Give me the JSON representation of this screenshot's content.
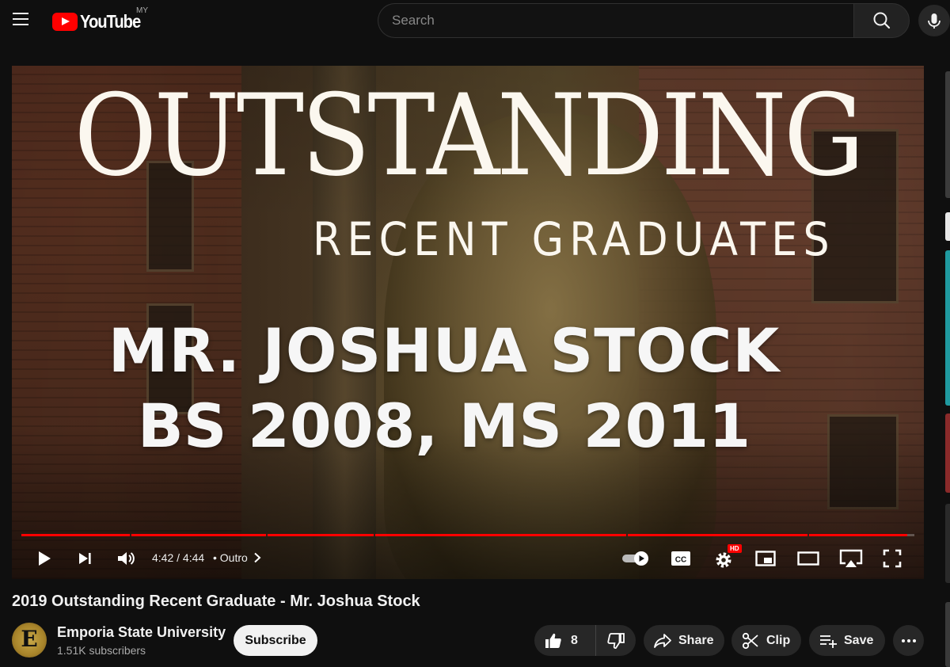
{
  "header": {
    "logo_text": "YouTube",
    "country_code": "MY",
    "search_placeholder": "Search"
  },
  "player": {
    "overlay": {
      "title_big": "OUTSTANDING",
      "title_sub": "RECENT GRADUATES",
      "name_line_1": "MR. JOSHUA STOCK",
      "name_line_2": "BS 2008, MS 2011"
    },
    "progress_fraction": 0.992,
    "time_display": "4:42 / 4:44",
    "chapter_label": "Outro",
    "hd_badge": "HD",
    "autoplay": true
  },
  "video": {
    "title": "2019 Outstanding Recent Graduate - Mr. Joshua Stock"
  },
  "channel": {
    "name": "Emporia State University",
    "subscribers": "1.51K subscribers",
    "avatar_letter": "E",
    "subscribe_label": "Subscribe"
  },
  "actions": {
    "like_count": "8",
    "share_label": "Share",
    "clip_label": "Clip",
    "save_label": "Save"
  },
  "colors": {
    "accent": "#ff0000",
    "background": "#0f0f0f",
    "pill": "#272727"
  }
}
